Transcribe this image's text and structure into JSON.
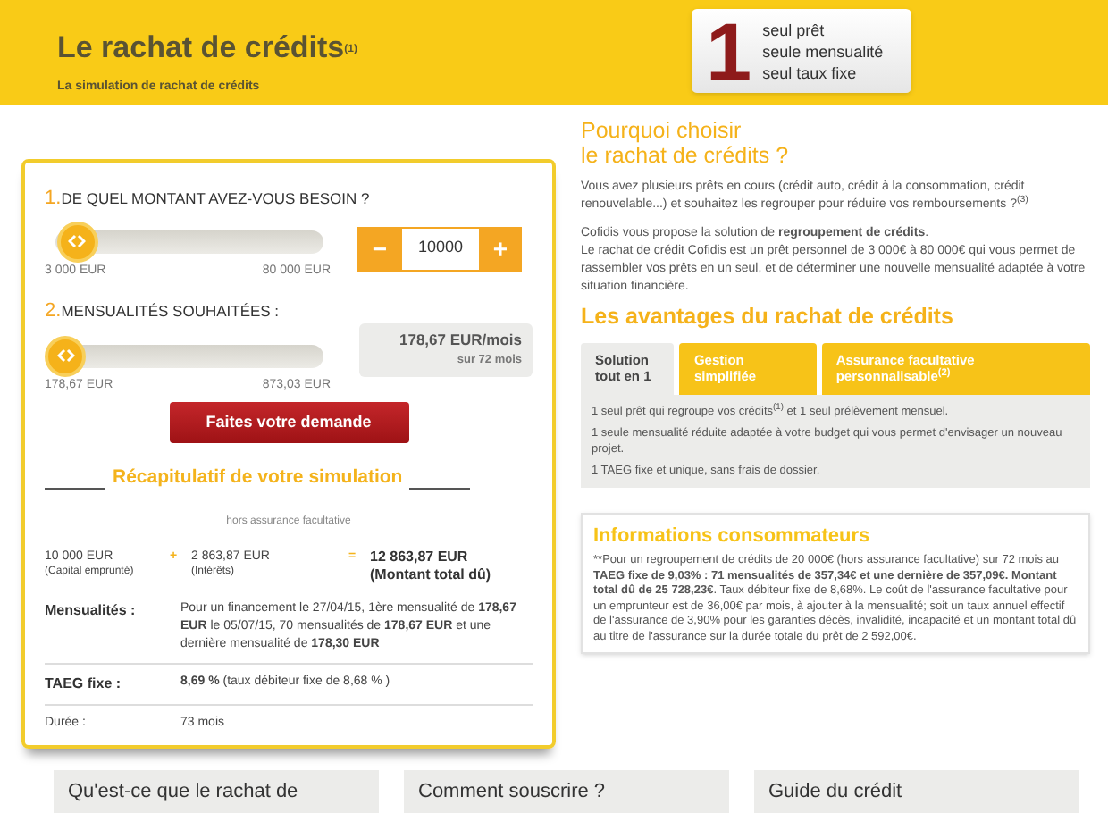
{
  "header": {
    "title": "Le rachat de crédits",
    "title_note": "(1)",
    "subtitle": "La simulation de rachat de crédits",
    "badge": {
      "number": "1",
      "lines": [
        "seul prêt",
        "seule mensualité",
        "seul taux fixe"
      ]
    }
  },
  "simulator": {
    "amount": {
      "step": "1.",
      "label": "DE QUEL MONTANT AVEZ-VOUS BESOIN ?",
      "level": 0.05,
      "min": "3 000 EUR",
      "max": "80 000 EUR",
      "minus": "−",
      "value": "10000",
      "plus": "+"
    },
    "monthly": {
      "step": "2.",
      "label": "MENSUALITÉS SOUHAITÉES :",
      "level": 0,
      "min": "178,67 EUR",
      "max": "873,03 EUR",
      "reading": "178,67 EUR/mois",
      "duration": "sur 72 mois"
    },
    "submit": "Faites votre demande",
    "summary": {
      "title": "Récapitulatif de votre simulation",
      "note": "hors assurance facultative",
      "capital": "10 000 EUR",
      "capital_label": "(Capital emprunté)",
      "plus": "+",
      "interest": "2 863,87 EUR",
      "interest_label": "(Intérêts)",
      "equals": "=",
      "total": "12 863,87 EUR",
      "total_label": "(Montant total dû)",
      "rows": [
        {
          "label": "Mensualités :",
          "kind": "strong",
          "value": "Pour un financement le 27/04/15, 1ère mensualité de **178,67 EUR** le 05/07/15, 70 mensualités de **178,67 EUR** et une dernière mensualité de **178,30 EUR**"
        },
        {
          "label": "TAEG fixe :",
          "kind": "strong",
          "value": "**8,69 %** (taux débiteur fixe de 8,68 % )"
        },
        {
          "label": "Durée :",
          "kind": "plain",
          "value": "73 mois"
        }
      ]
    }
  },
  "why": {
    "title": [
      "Pourquoi choisir",
      "le rachat de crédits ?"
    ],
    "paragraphs": [
      "Vous avez plusieurs prêts en cours (crédit auto, crédit à la consommation, crédit renouvelable...) et souhaitez les regrouper pour réduire vos remboursements ?$^{(3)}$",
      "Cofidis vous propose la solution de **regroupement de crédits**.",
      "Le rachat de crédit Cofidis est un prêt personnel de 3 000€ à 80 000€ qui vous permet de rassembler vos prêts en un seul, et de déterminer une nouvelle mensualité adaptée à votre situation financière."
    ]
  },
  "advantages": {
    "title": "Les avantages du rachat de crédits",
    "tabs": [
      {
        "label": "Solution tout en 1",
        "selected": true
      },
      {
        "label": "Gestion simplifiée",
        "selected": false
      },
      {
        "label": "Assurance facultative personnalisable$^{(2)}$",
        "selected": false
      }
    ],
    "items": [
      "1 seul prêt qui regroupe vos crédits$^{(1)}$ et 1 seul prélèvement mensuel.",
      "1 seule mensualité réduite adaptée à votre budget qui vous permet d'envisager un nouveau projet.",
      "1 TAEG fixe et unique, sans frais de dossier."
    ]
  },
  "info": {
    "title": "Informations consommateurs",
    "marker": "**",
    "text": "Pour un regroupement de crédits de 20 000€ (hors assurance facultative) sur 72 mois au **TAEG fixe de 9,03% : 71 mensualités de 357,34€ et une dernière de 357,09€. Montant total dû de 25 728,23€**. Taux débiteur fixe de 8,68%. Le coût de l'assurance facultative pour un emprunteur est de 36,00€ par mois, à ajouter à la mensualité; soit un taux annuel effectif de l'assurance de 3,90% pour les garanties décès, invalidité, incapacité et un montant total dû au titre de l'assurance sur la durée totale du prêt de 2 592,00€."
  },
  "bottom_cards": [
    "Qu'est-ce que le rachat de",
    "Comment souscrire ?",
    "Guide du crédit"
  ]
}
